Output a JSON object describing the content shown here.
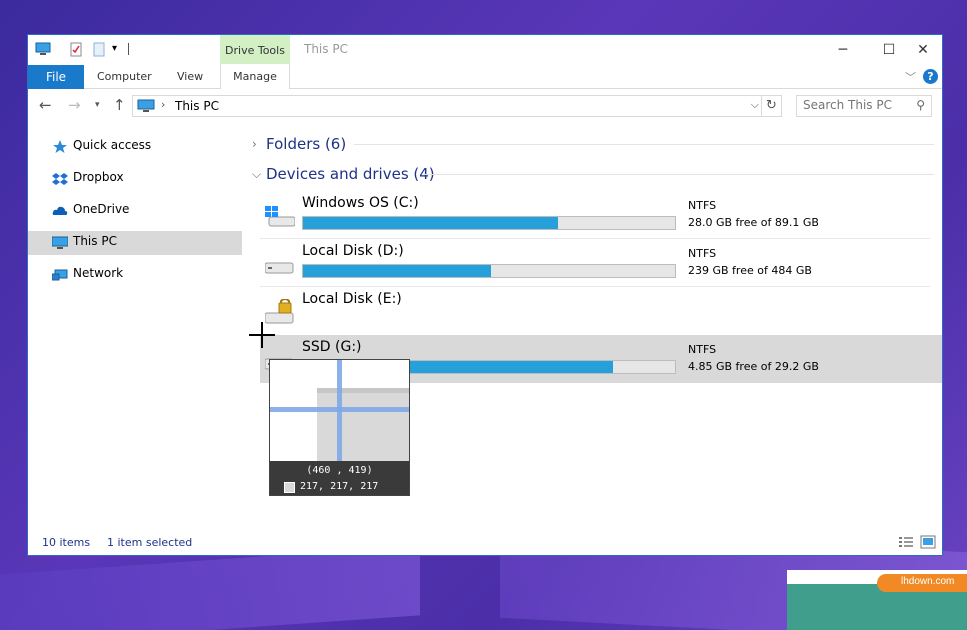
{
  "window": {
    "title": "This PC",
    "context_tab": "Drive Tools",
    "controls": {
      "minimize": "─",
      "maximize": "☐",
      "close": "✕"
    }
  },
  "ribbon": {
    "file": "File",
    "tabs": [
      "Computer",
      "View"
    ],
    "manage": "Manage",
    "collapse_icon": "chevron-down-icon",
    "help": "?"
  },
  "address": {
    "location": "This PC",
    "separator": "›",
    "search_placeholder": "Search This PC"
  },
  "nav": {
    "items": [
      {
        "label": "Quick access",
        "icon": "star-icon"
      },
      {
        "label": "Dropbox",
        "icon": "dropbox-icon"
      },
      {
        "label": "OneDrive",
        "icon": "cloud-icon"
      },
      {
        "label": "This PC",
        "icon": "computer-icon",
        "selected": true
      },
      {
        "label": "Network",
        "icon": "network-icon"
      }
    ]
  },
  "groups": {
    "folders": "Folders (6)",
    "devices": "Devices and drives (4)"
  },
  "drives": [
    {
      "name": "Windows OS (C:)",
      "fs": "NTFS",
      "free": "28.0 GB free of 89.1 GB",
      "used_fraction": 0.686
    },
    {
      "name": "Local Disk (D:)",
      "fs": "NTFS",
      "free": "239 GB free of 484 GB",
      "used_fraction": 0.506
    },
    {
      "name": "Local Disk (E:)",
      "locked": true
    },
    {
      "name": "SSD (G:)",
      "fs": "NTFS",
      "free": "4.85 GB free of 29.2 GB",
      "used_fraction": 0.834,
      "selected": true
    }
  ],
  "status": {
    "items": "10 items",
    "selected": "1 item selected"
  },
  "magnifier": {
    "coords": "(460 , 419)",
    "rgb": "217, 217, 217",
    "swatch_color": "#d9d9d9"
  },
  "watermark": "lhdown.com",
  "colors": {
    "accent": "#1979ca",
    "bar_fill": "#26a0da",
    "context_tab": "#d3f0c4",
    "selection": "#d9d9d9"
  }
}
